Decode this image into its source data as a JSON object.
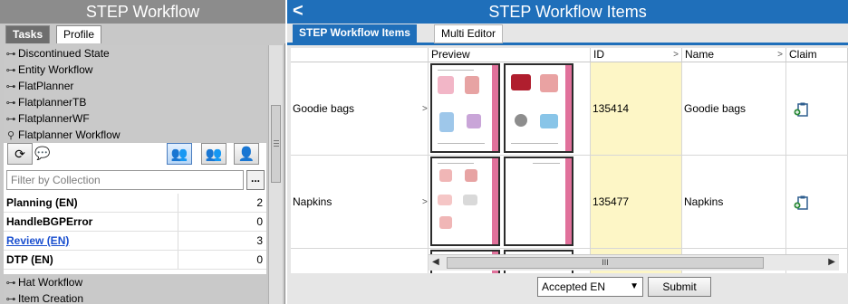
{
  "left_panel": {
    "title": "STEP Workflow",
    "tabs": [
      {
        "label": "Tasks"
      },
      {
        "label": "Profile"
      }
    ],
    "tree_items": [
      {
        "label": "Discontinued State",
        "icon": "key-icon"
      },
      {
        "label": "Entity Workflow",
        "icon": "key-icon"
      },
      {
        "label": "FlatPlanner",
        "icon": "key-icon"
      },
      {
        "label": "FlatplannerTB",
        "icon": "key-icon"
      },
      {
        "label": "FlatplannerWF",
        "icon": "key-icon"
      },
      {
        "label": "Flatplanner Workflow",
        "icon": "key-expanded-icon"
      }
    ],
    "toolbar": {
      "refresh_icon": "refresh-icon",
      "comment_icon": "speech-bubble-icon"
    },
    "filter_placeholder": "Filter by Collection",
    "filter_button": "...",
    "states": [
      {
        "name": "Planning (EN)",
        "count": "2"
      },
      {
        "name": "HandleBGPError",
        "count": "0"
      },
      {
        "name": "Review (EN)",
        "count": "3",
        "link": true
      },
      {
        "name": "DTP (EN)",
        "count": "0"
      }
    ],
    "more_tree_items": [
      {
        "label": "Hat Workflow"
      },
      {
        "label": "Item Creation"
      }
    ]
  },
  "right_panel": {
    "title": "STEP Workflow Items",
    "back_icon": "back-arrow-icon",
    "tabs": [
      {
        "label": "STEP Workflow Items"
      },
      {
        "label": "Multi Editor"
      }
    ],
    "columns": [
      {
        "label": ""
      },
      {
        "label": "Preview"
      },
      {
        "label": "ID"
      },
      {
        "label": "Name"
      },
      {
        "label": "Claim"
      }
    ],
    "rows": [
      {
        "title": "Goodie bags",
        "id": "135414",
        "name": "Goodie bags",
        "claim_icon": "claim-clipboard-icon"
      },
      {
        "title": "Napkins",
        "id": "135477",
        "name": "Napkins",
        "claim_icon": "claim-clipboard-icon"
      }
    ],
    "scroll_grip": "III",
    "state_select": "Accepted EN",
    "submit": "Submit"
  },
  "colors": {
    "accent": "#1f6fba",
    "id_column": "#fdf6c6",
    "thumbnail_band": "#e1719b"
  }
}
